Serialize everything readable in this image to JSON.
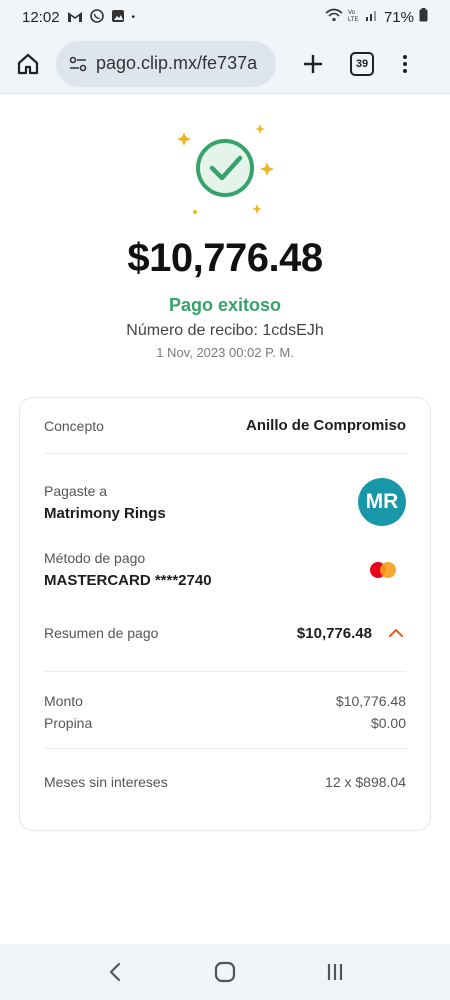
{
  "status_bar": {
    "time": "12:02",
    "notif_icons": [
      "gmail-icon",
      "whatsapp-icon",
      "image-icon"
    ],
    "dot": "•",
    "battery": "71%"
  },
  "browser": {
    "url": "pago.clip.mx/fe737a",
    "tab_count": "39"
  },
  "receipt": {
    "amount": "$10,776.48",
    "status": "Pago exitoso",
    "receipt_number": "Número de recibo: 1cdsEJh",
    "date": "1 Nov, 2023 00:02 P. M."
  },
  "details": {
    "concept_label": "Concepto",
    "concept_value": "Anillo de Compromiso",
    "paid_to_label": "Pagaste a",
    "paid_to_value": "Matrimony Rings",
    "avatar_initials": "MR",
    "method_label": "Método de pago",
    "method_value": "MASTERCARD ****2740",
    "summary_label": "Resumen de pago",
    "summary_value": "$10,776.48",
    "amount_label": "Monto",
    "amount_value": "$10,776.48",
    "tip_label": "Propina",
    "tip_value": "$0.00",
    "msi_label": "Meses sin intereses",
    "msi_value": "12 x $898.04"
  },
  "colors": {
    "success_green": "#36a36b",
    "avatar_teal": "#1897a8",
    "accent_orange": "#e0662f",
    "sparkle_gold": "#f0b51e"
  }
}
